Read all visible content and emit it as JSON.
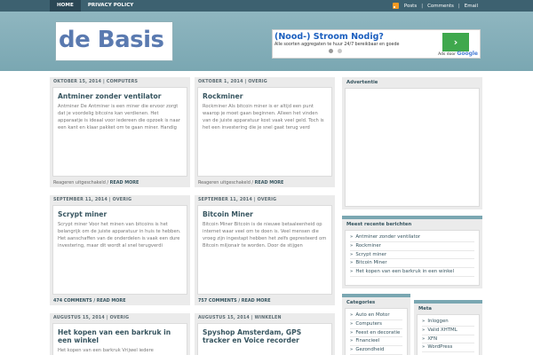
{
  "nav": {
    "home": "HOME",
    "privacy": "PRIVACY POLICY",
    "posts": "Posts",
    "comments": "Comments",
    "email": "Email",
    "rss_icon": "rss-icon"
  },
  "header": {
    "logo_text": "de Basis"
  },
  "ad": {
    "headline": "(Nood-) Stroom Nodig?",
    "sub": "Alle soorten aggregaten te huur 24/7 bereikbaar en goede",
    "go_label": "›",
    "by_label": "Ads door",
    "by_brand": "Google"
  },
  "posts": [
    {
      "meta": "OKTOBER 15, 2014 | COMPUTERS",
      "title": "Antminer zonder ventilator",
      "excerpt": "Antminer De Antminer is een miner die ervoor zorgt dat je voordelig bitcoins kan verdienen. Het apparaatje is ideaal voor iedereen die opzoek is naar een kant en klaar pakket om te gaan miner. Handig",
      "foot_text": "Reageren uitgeschakeld /",
      "foot_link": "READ MORE"
    },
    {
      "meta": "OKTOBER 1, 2014 | OVERIG",
      "title": "Rockminer",
      "excerpt": "Rockminer Als bitcoin miner is er altijd een punt waarop je moet gaan beginnen. Alleen het vinden van de juiste apparatuur kost vaak veel geld. Toch is het een investering die je snel gaat terug verd",
      "foot_text": "Reageren uitgeschakeld /",
      "foot_link": "READ MORE"
    },
    {
      "meta": "SEPTEMBER 11, 2014 | OVERIG",
      "title": "Scrypt miner",
      "excerpt": "Scrypt miner Voor het minen van bitcoins is het belangrijk om de juiste apparatuur in huis te hebben. Het aanschaffen van de onderdelen is vaak een dure investering, maar dit wordt al snel terugverdi",
      "foot_text": "474 COMMENTS /",
      "foot_link": "READ MORE"
    },
    {
      "meta": "SEPTEMBER 11, 2014 | OVERIG",
      "title": "Bitcoin Miner",
      "excerpt": "Bitcoin Miner Bitcoin is de nieuwe betaaleenheid op internet waar veel om te doen is. Veel mensen die vroeg zijn ingestapt hebben het zelfs gepresteerd om Bitcoin miljonair te worden. Door de stijgen",
      "foot_text": "757 COMMENTS /",
      "foot_link": "READ MORE"
    },
    {
      "meta": "AUGUSTUS 15, 2014 | OVERIG",
      "title": "Het kopen van een barkruk in een winkel",
      "excerpt": "Het kopen van een barkruk Vrijwel iedere",
      "foot_text": "",
      "foot_link": ""
    },
    {
      "meta": "AUGUSTUS 15, 2014 | WINKELEN",
      "title": "Spyshop Amsterdam, GPS tracker en Voice recorder",
      "excerpt": "",
      "foot_text": "",
      "foot_link": ""
    }
  ],
  "sidebar": {
    "ad_title": "Advertentie",
    "recent_title": "Meest recente berichten",
    "recent": [
      "Antminer zonder ventilator",
      "Rockminer",
      "Scrypt miner",
      "Bitcoin Miner",
      "Het kopen van een barkruk in een winkel"
    ],
    "categories_title": "Categories",
    "categories": [
      "Auto en Motor",
      "Computers",
      "Feest en decoratie",
      "Financieel",
      "Gezondheid"
    ],
    "meta_title": "Meta",
    "meta": [
      "Inloggen",
      "Valid XHTML",
      "XFN",
      "WordPress"
    ]
  }
}
